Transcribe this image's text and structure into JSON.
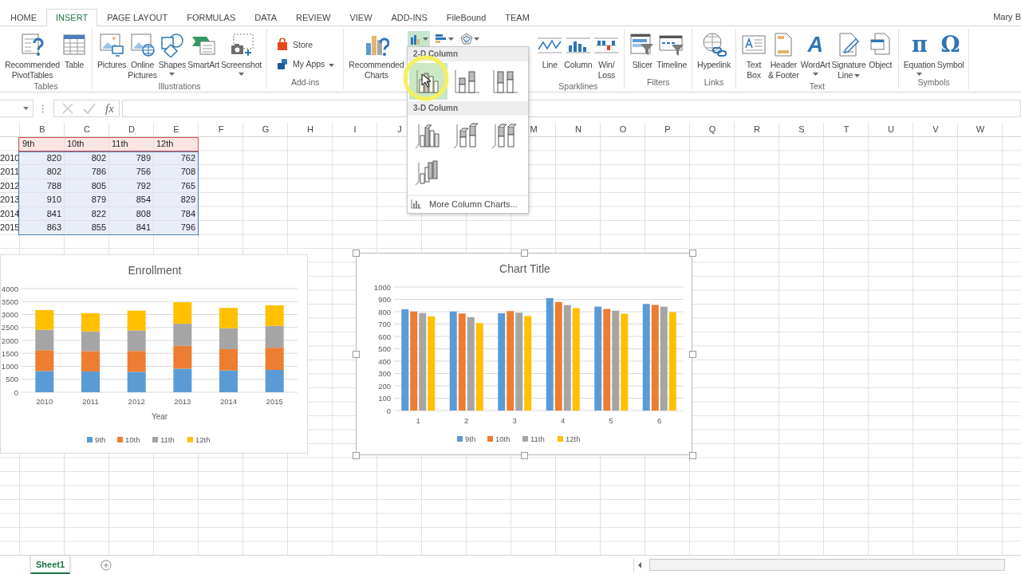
{
  "tabs": [
    {
      "label": "HOME",
      "selected": false
    },
    {
      "label": "INSERT",
      "selected": true
    },
    {
      "label": "PAGE LAYOUT",
      "selected": false
    },
    {
      "label": "FORMULAS",
      "selected": false
    },
    {
      "label": "DATA",
      "selected": false
    },
    {
      "label": "REVIEW",
      "selected": false
    },
    {
      "label": "VIEW",
      "selected": false
    },
    {
      "label": "ADD-INS",
      "selected": false
    },
    {
      "label": "FileBound",
      "selected": false
    },
    {
      "label": "TEAM",
      "selected": false
    }
  ],
  "user": "Mary B",
  "ribbon": {
    "groups": [
      {
        "kind": "large",
        "label": "Tables",
        "buttons": [
          {
            "lines": [
              "Recommended",
              "PivotTables"
            ]
          },
          {
            "lines": [
              "Table"
            ]
          }
        ]
      },
      {
        "kind": "large",
        "label": "Illustrations",
        "buttons": [
          {
            "lines": [
              "Pictures"
            ]
          },
          {
            "lines": [
              "Online",
              "Pictures"
            ]
          },
          {
            "lines": [
              "Shapes"
            ],
            "dropdown": true
          },
          {
            "lines": [
              "SmartArt"
            ]
          },
          {
            "lines": [
              "Screenshot"
            ],
            "dropdown": true
          }
        ]
      },
      {
        "kind": "small",
        "label": "Add-ins",
        "buttons": [
          {
            "lines": [
              "Store"
            ]
          },
          {
            "lines": [
              "My Apps"
            ],
            "dropdown": true
          }
        ]
      },
      {
        "kind": "charts",
        "buttons": [
          {
            "lines": [
              "Recommended",
              "Charts"
            ]
          }
        ],
        "chart_types": [
          {
            "selected": true
          },
          {
            "selected": false
          },
          {
            "selected": false
          }
        ]
      },
      {
        "kind": "large",
        "label": "Sparklines",
        "buttons": [
          {
            "lines": [
              "Line"
            ]
          },
          {
            "lines": [
              "Column"
            ]
          },
          {
            "lines": [
              "Win/",
              "Loss"
            ]
          }
        ]
      },
      {
        "kind": "large",
        "label": "Filters",
        "buttons": [
          {
            "lines": [
              "Slicer"
            ]
          },
          {
            "lines": [
              "Timeline"
            ]
          }
        ]
      },
      {
        "kind": "large",
        "label": "Links",
        "buttons": [
          {
            "lines": [
              "Hyperlink"
            ]
          }
        ]
      },
      {
        "kind": "large",
        "label": "Text",
        "buttons": [
          {
            "lines": [
              "Text",
              "Box"
            ]
          },
          {
            "lines": [
              "Header",
              "& Footer"
            ]
          },
          {
            "lines": [
              "WordArt"
            ],
            "glyph": "A",
            "dropdown": true
          },
          {
            "lines": [
              "Signature",
              "Line"
            ],
            "dropdown": true
          },
          {
            "lines": [
              "Object"
            ]
          }
        ]
      },
      {
        "kind": "large",
        "label": "Symbols",
        "buttons": [
          {
            "lines": [
              "Equation"
            ],
            "glyph": "π",
            "dropdown": true
          },
          {
            "lines": [
              "Symbol"
            ],
            "glyph": "Ω"
          }
        ]
      }
    ]
  },
  "formula_bar": {
    "fx": "fx"
  },
  "sheet": {
    "columns": [
      "B",
      "C",
      "D",
      "E",
      "F",
      "G",
      "H",
      "I",
      "J",
      null,
      null,
      "M",
      "N",
      "O",
      "P",
      "Q",
      "R",
      "S",
      "T",
      "U",
      "V",
      "W"
    ],
    "header": [
      "9th",
      "10th",
      "11th",
      "12th"
    ],
    "rows": [
      {
        "cells": [
          "2010",
          "820",
          "802",
          "789",
          "762"
        ]
      },
      {
        "cells": [
          "2011",
          "802",
          "786",
          "756",
          "708"
        ]
      },
      {
        "cells": [
          "2012",
          "788",
          "805",
          "792",
          "765"
        ]
      },
      {
        "cells": [
          "2013",
          "910",
          "879",
          "854",
          "829"
        ]
      },
      {
        "cells": [
          "2014",
          "841",
          "822",
          "808",
          "784"
        ]
      },
      {
        "cells": [
          "2015",
          "863",
          "855",
          "841",
          "796"
        ]
      }
    ]
  },
  "charts": [
    {
      "selected": false,
      "chart_data": {
        "type": "bar",
        "title": "Enrollment",
        "xlabel": "Year",
        "grid": true,
        "legend": "bottom",
        "categories": [
          "2010",
          "2011",
          "2012",
          "2013",
          "2014",
          "2015"
        ],
        "stacked": true,
        "ylim": [
          0,
          4000
        ],
        "yticks": [
          0,
          500,
          1000,
          1500,
          2000,
          2500,
          3000,
          3500,
          4000
        ],
        "series": [
          {
            "name": "9th",
            "color": "#5b9bd5",
            "values": [
              820,
              802,
              788,
              910,
              841,
              863
            ]
          },
          {
            "name": "10th",
            "color": "#ed7d31",
            "values": [
              802,
              786,
              805,
              879,
              822,
              855
            ]
          },
          {
            "name": "11th",
            "color": "#a5a5a5",
            "values": [
              789,
              756,
              792,
              854,
              808,
              841
            ]
          },
          {
            "name": "12th",
            "color": "#ffc000",
            "values": [
              762,
              708,
              765,
              829,
              784,
              796
            ]
          }
        ]
      }
    },
    {
      "selected": true,
      "chart_data": {
        "type": "bar",
        "title": "Chart Title",
        "grid": true,
        "legend": "bottom",
        "categories": [
          "1",
          "2",
          "3",
          "4",
          "5",
          "6"
        ],
        "stacked": false,
        "ylim": [
          0,
          1000
        ],
        "yticks": [
          0,
          100,
          200,
          300,
          400,
          500,
          600,
          700,
          800,
          900,
          1000
        ],
        "series": [
          {
            "name": "9th",
            "color": "#5b9bd5",
            "values": [
              820,
              802,
              788,
              910,
              841,
              863
            ]
          },
          {
            "name": "10th",
            "color": "#ed7d31",
            "values": [
              802,
              786,
              805,
              879,
              822,
              855
            ]
          },
          {
            "name": "11th",
            "color": "#a5a5a5",
            "values": [
              789,
              756,
              792,
              854,
              808,
              841
            ]
          },
          {
            "name": "12th",
            "color": "#ffc000",
            "values": [
              762,
              708,
              765,
              829,
              784,
              796
            ]
          }
        ]
      }
    }
  ],
  "column_menu": {
    "sections": [
      {
        "title": "2-D Column",
        "options": [
          {
            "kind": "clustered",
            "selected": true
          },
          {
            "kind": "stacked",
            "selected": false
          },
          {
            "kind": "percent",
            "selected": false
          }
        ]
      },
      {
        "title": "3-D Column",
        "options": [
          {
            "kind": "clustered3d",
            "selected": false
          },
          {
            "kind": "stacked3d",
            "selected": false
          },
          {
            "kind": "percent3d",
            "selected": false
          },
          {
            "kind": "column3d",
            "selected": false
          }
        ]
      }
    ],
    "more": "More Column Charts..."
  },
  "sheet_tabs": [
    {
      "label": "Sheet1",
      "selected": true
    }
  ]
}
